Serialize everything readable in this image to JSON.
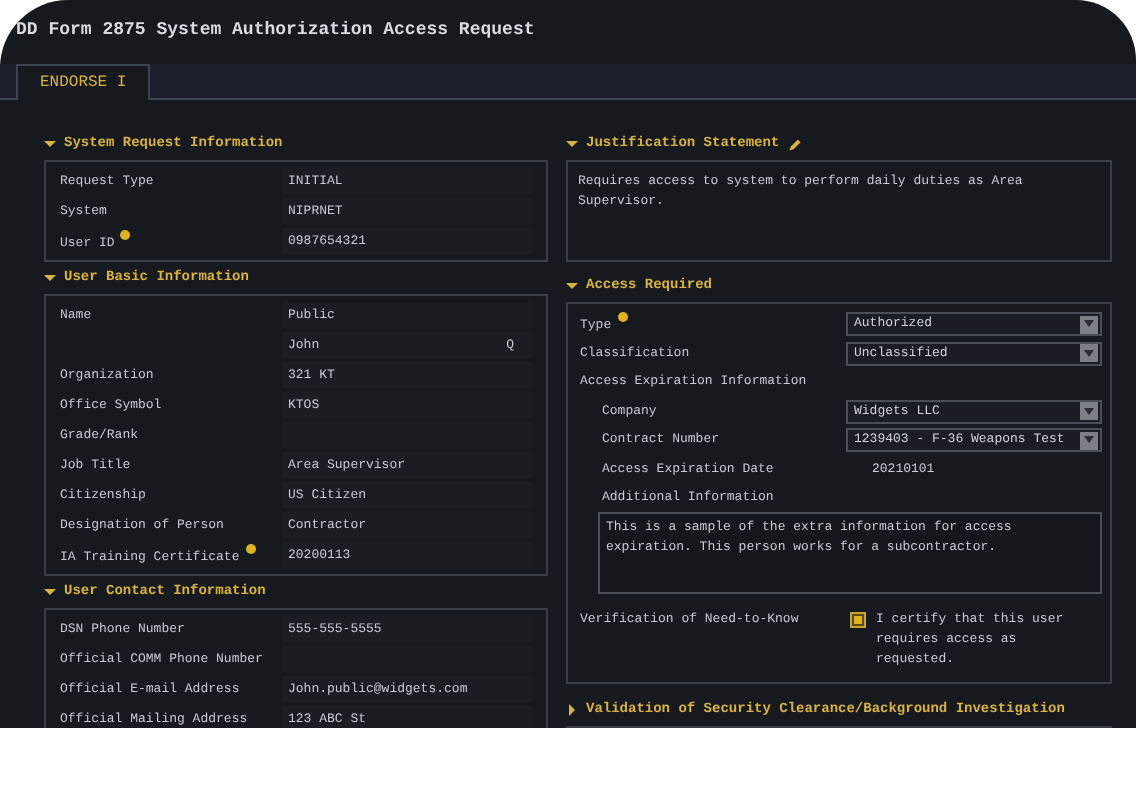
{
  "window": {
    "title": "DD Form 2875 System Authorization Access Request"
  },
  "tabs": [
    {
      "label": "ENDORSE I",
      "selected": true
    }
  ],
  "left_sections": [
    {
      "title": "System Request Information",
      "expanded": true,
      "rows": [
        {
          "label": "Request Type",
          "info": false,
          "values": [
            "INITIAL"
          ]
        },
        {
          "label": "System",
          "info": false,
          "values": [
            "NIPRNET"
          ]
        },
        {
          "label": "User ID",
          "info": true,
          "values": [
            "0987654321"
          ]
        }
      ]
    },
    {
      "title": "User Basic Information",
      "expanded": true,
      "rows": [
        {
          "label": "Name",
          "info": false,
          "values": [
            "Public"
          ]
        },
        {
          "label": "",
          "info": false,
          "values": [
            "John",
            "Q"
          ]
        },
        {
          "label": "Organization",
          "info": false,
          "values": [
            "321 KT"
          ]
        },
        {
          "label": "Office Symbol",
          "info": false,
          "values": [
            "KTOS"
          ]
        },
        {
          "label": "Grade/Rank",
          "info": false,
          "values": []
        },
        {
          "label": "Job Title",
          "info": false,
          "values": [
            "Area Supervisor"
          ]
        },
        {
          "label": "Citizenship",
          "info": false,
          "values": [
            "US Citizen"
          ]
        },
        {
          "label": "Designation of Person",
          "info": false,
          "values": [
            "Contractor"
          ]
        },
        {
          "label": "IA Training Certificate",
          "info": true,
          "values": [
            "20200113"
          ]
        }
      ]
    },
    {
      "title": "User Contact Information",
      "expanded": true,
      "rows": [
        {
          "label": "DSN Phone Number",
          "info": false,
          "values": [
            "555-555-5555"
          ]
        },
        {
          "label": "Official COMM Phone Number",
          "info": false,
          "values": []
        },
        {
          "label": "Official E-mail Address",
          "info": false,
          "values": [
            "John.public@widgets.com"
          ]
        },
        {
          "label": "Official Mailing Address",
          "info": false,
          "values": [
            "123 ABC St"
          ]
        }
      ]
    }
  ],
  "justification": {
    "title": "Justification Statement",
    "expanded": true,
    "text": "Requires access to system to perform daily duties as Area Supervisor."
  },
  "access_required": {
    "title": "Access Required",
    "expanded": true,
    "rows": [
      {
        "kind": "select",
        "label": "Type",
        "info": true,
        "value": "Authorized"
      },
      {
        "kind": "select",
        "label": "Classification",
        "info": false,
        "value": "Unclassified"
      },
      {
        "kind": "group",
        "label": "Access Expiration Information",
        "info": false,
        "children": [
          {
            "kind": "select",
            "label": "Company",
            "info": false,
            "value": "Widgets LLC"
          },
          {
            "kind": "select",
            "label": "Contract Number",
            "info": false,
            "value": "1239403 - F-36 Weapons Test"
          },
          {
            "kind": "text",
            "label": "Access Expiration Date",
            "info": false,
            "value": "20210101"
          },
          {
            "kind": "textarea",
            "label": "Additional Information",
            "info": false,
            "value": "This is a sample of the extra information for access expiration. This person works for a subcontractor."
          }
        ]
      },
      {
        "kind": "checkbox",
        "label": "Verification of Need-to-Know",
        "info": false,
        "checked": true,
        "text": "I certify that this user requires access as requested."
      }
    ]
  },
  "validation": {
    "title": "Validation of Security Clearance/Background Investigation",
    "expanded": false
  }
}
